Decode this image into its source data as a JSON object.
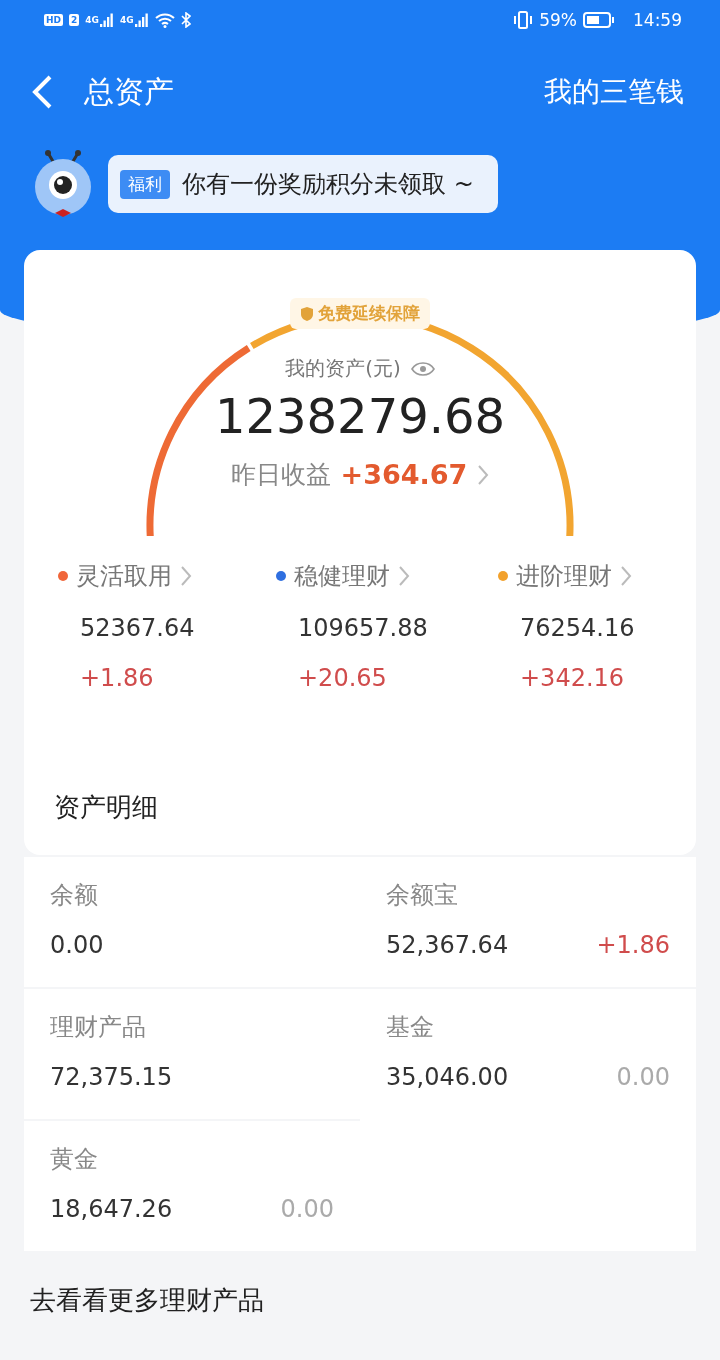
{
  "status_bar": {
    "badges": [
      "HD",
      "2"
    ],
    "networks": [
      "4G",
      "4G"
    ],
    "battery": "59%",
    "time": "14:59"
  },
  "nav": {
    "title": "总资产",
    "action": "我的三笔钱"
  },
  "promo": {
    "tag": "福利",
    "text": "你有一份奖励积分未领取 ~"
  },
  "summary": {
    "badge": "免费延续保障",
    "label": "我的资产(元)",
    "total": "1238279.68",
    "yesterday_label": "昨日收益",
    "yesterday_value": "+364.67"
  },
  "categories": [
    {
      "name": "灵活取用",
      "color": "#f0663a",
      "amount": "52367.64",
      "change": "+1.86"
    },
    {
      "name": "稳健理财",
      "color": "#2f6fe0",
      "amount": "109657.88",
      "change": "+20.65"
    },
    {
      "name": "进阶理财",
      "color": "#f2a12c",
      "amount": "76254.16",
      "change": "+342.16"
    }
  ],
  "details": {
    "title": "资产明细",
    "items": [
      {
        "label": "余额",
        "value": "0.00"
      },
      {
        "label": "余额宝",
        "value": "52,367.64",
        "change": "+1.86",
        "kind": "gain"
      },
      {
        "label": "理财产品",
        "value": "72,375.15"
      },
      {
        "label": "基金",
        "value": "35,046.00",
        "change": "0.00",
        "kind": "flat"
      },
      {
        "label": "黄金",
        "value": "18,647.26",
        "change": "0.00",
        "kind": "flat"
      }
    ]
  },
  "footer_link": "去看看更多理财产品"
}
